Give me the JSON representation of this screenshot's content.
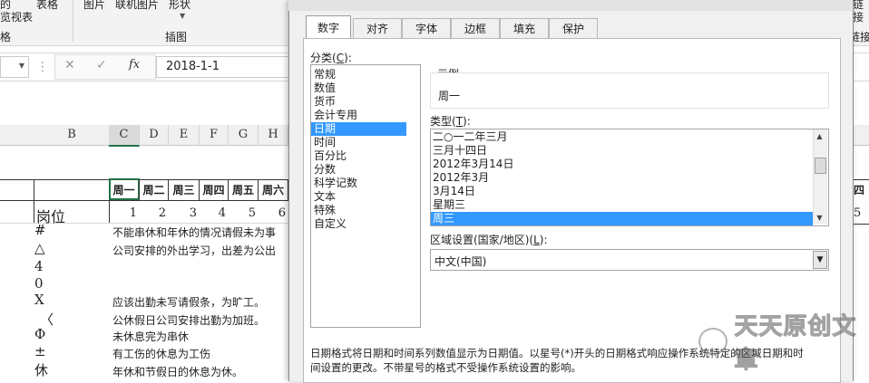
{
  "ribbon": {
    "labels": [
      "的",
      "表格",
      "图片",
      "联机图片",
      "形状",
      "览视表",
      "格",
      "插图"
    ],
    "right_labels": [
      "链",
      "接",
      "链接"
    ]
  },
  "formula_bar": {
    "cancel": "✕",
    "enter": "✓",
    "fx": "fx",
    "value": "2018-1-1"
  },
  "sheet": {
    "columns": [
      "B",
      "C",
      "D",
      "E",
      "F",
      "G",
      "H"
    ],
    "days": [
      "周一",
      "周二",
      "周三",
      "周四",
      "周五",
      "周六"
    ],
    "day_partial": "四",
    "position_label": "岗位",
    "numbers": [
      "1",
      "2",
      "3",
      "4",
      "5",
      "6"
    ],
    "number_partial": "5",
    "rows": [
      {
        "symbol": "#",
        "text": "不能串休和年休的情况请假未为事"
      },
      {
        "symbol": "△",
        "text": "公司安排的外出学习，出差为公出"
      },
      {
        "symbol": "4",
        "text": ""
      },
      {
        "symbol": "0",
        "text": ""
      },
      {
        "symbol": "X",
        "text": "应该出勤未写请假条，为旷工。"
      },
      {
        "symbol": "〈",
        "text": "公休假日公司安排出勤为加班。"
      },
      {
        "symbol": "Φ",
        "text": "未休息完为串休"
      },
      {
        "symbol": "±",
        "text": "有工伤的休息为工伤"
      },
      {
        "symbol": "休",
        "text": "年休和节假日的休息为休。"
      }
    ]
  },
  "dialog": {
    "tabs": [
      "数字",
      "对齐",
      "字体",
      "边框",
      "填充",
      "保护"
    ],
    "active_tab": "数字",
    "category_label": "分类(",
    "category_key": "C",
    "category_label_end": "):",
    "categories": [
      "常规",
      "数值",
      "货币",
      "会计专用",
      "日期",
      "时间",
      "百分比",
      "分数",
      "科学记数",
      "文本",
      "特殊",
      "自定义"
    ],
    "selected_category": "日期",
    "sample_label": "示例",
    "sample_value": "周一",
    "type_label": "类型(",
    "type_key": "T",
    "type_label_end": "):",
    "types": [
      "二○一二年三月",
      "三月十四日",
      "2012年3月14日",
      "2012年3月",
      "3月14日",
      "星期三",
      "周三"
    ],
    "selected_type": "周三",
    "locale_label": "区域设置(国家/地区)(",
    "locale_key": "L",
    "locale_label_end": "):",
    "locale_value": "中文(中国)",
    "description_line1": "日期格式将日期和时间系列数值显示为日期值。以星号(*)开头的日期格式响应操作系统特定的区域日期和时",
    "description_line2": "间设置的更改。不带星号的格式不受操作系统设置的影响。"
  },
  "watermark": {
    "text": "天天原创文章"
  },
  "colors": {
    "selection": "#3399ff",
    "dialog_bg": "#f0f0f0",
    "ribbon_bg": "#f3f3f3"
  }
}
